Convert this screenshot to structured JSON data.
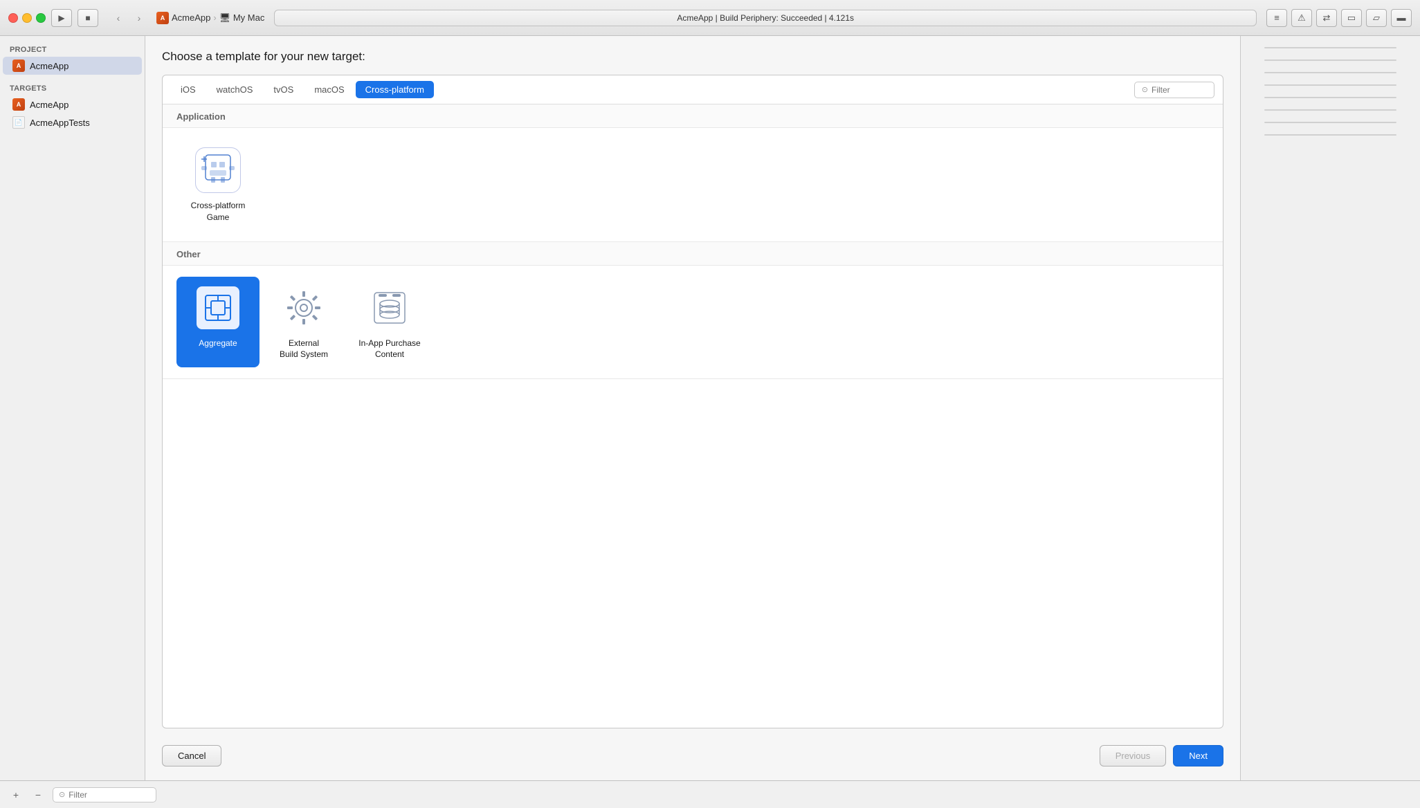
{
  "window": {
    "title": "AcmeApp",
    "subtitle": "My Mac",
    "status": "AcmeApp  |  Build Periphery: Succeeded  |  4.121s"
  },
  "toolbar": {
    "play_label": "▶",
    "stop_label": "■",
    "nav_back": "‹",
    "nav_forward": "›",
    "filter_placeholder": "Filter"
  },
  "sidebar": {
    "project_label": "PROJECT",
    "targets_label": "TARGETS",
    "items": [
      {
        "id": "acmeapp-project",
        "label": "AcmeApp",
        "type": "project"
      },
      {
        "id": "acmeapp-target",
        "label": "AcmeApp",
        "type": "target"
      },
      {
        "id": "acmepptests-target",
        "label": "AcmeAppTests",
        "type": "tests"
      }
    ]
  },
  "content": {
    "page_title": "Choose a template for your new target:",
    "tabs": [
      {
        "id": "ios",
        "label": "iOS"
      },
      {
        "id": "watchos",
        "label": "watchOS"
      },
      {
        "id": "tvos",
        "label": "tvOS"
      },
      {
        "id": "macos",
        "label": "macOS"
      },
      {
        "id": "cross-platform",
        "label": "Cross-platform",
        "active": true
      }
    ],
    "filter_placeholder": "Filter",
    "sections": [
      {
        "id": "application",
        "label": "Application",
        "items": [
          {
            "id": "cross-platform-game",
            "label": "Cross-platform\nGame",
            "selected": false,
            "icon": "game-icon"
          }
        ]
      },
      {
        "id": "other",
        "label": "Other",
        "items": [
          {
            "id": "aggregate",
            "label": "Aggregate",
            "selected": true,
            "icon": "aggregate-icon"
          },
          {
            "id": "external-build-system",
            "label": "External\nBuild System",
            "selected": false,
            "icon": "gear-icon"
          },
          {
            "id": "in-app-purchase-content",
            "label": "In-App Purchase\nContent",
            "selected": false,
            "icon": "database-icon"
          }
        ]
      }
    ]
  },
  "actions": {
    "cancel_label": "Cancel",
    "previous_label": "Previous",
    "next_label": "Next"
  },
  "bottom_bar": {
    "filter_placeholder": "Filter",
    "add_label": "+",
    "remove_label": "−"
  }
}
